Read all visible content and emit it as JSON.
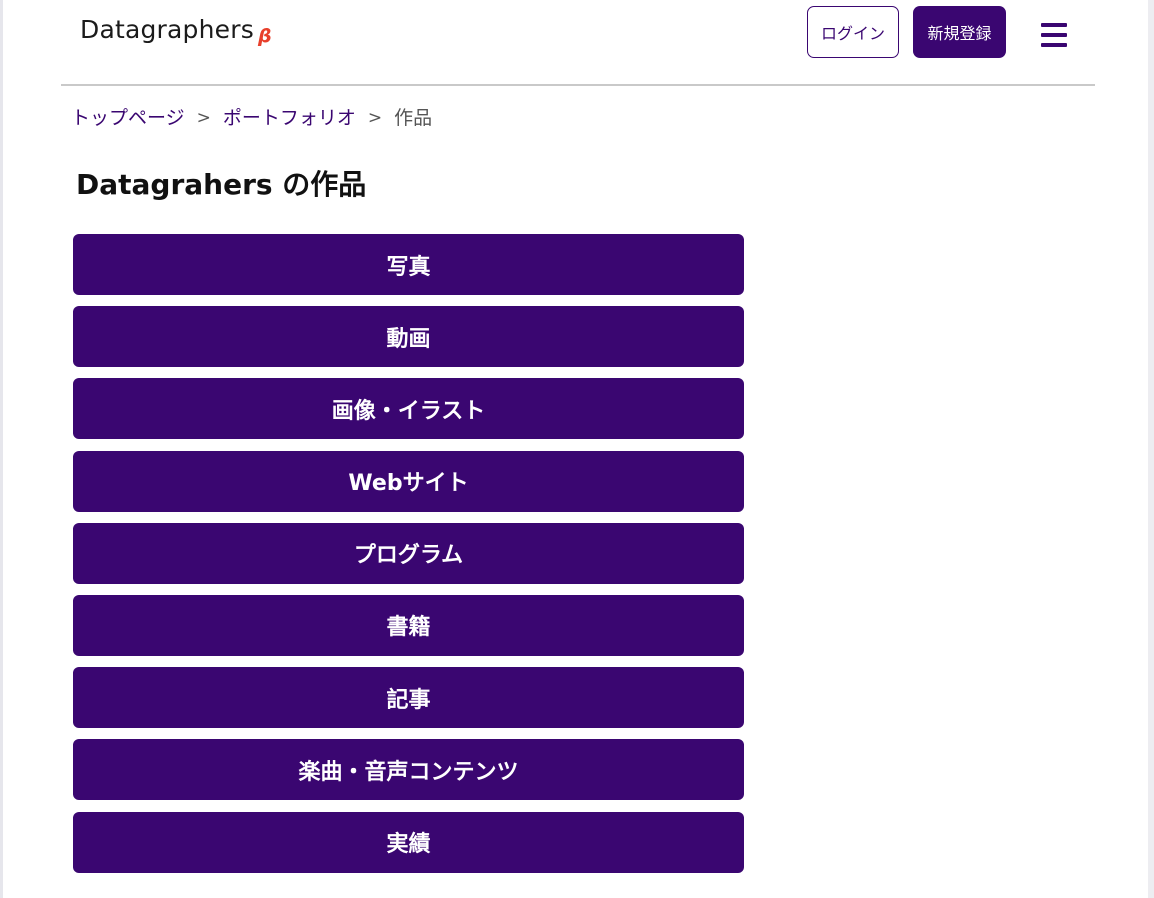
{
  "header": {
    "logo_text": "Datagraphers",
    "logo_badge": "β",
    "login_label": "ログイン",
    "register_label": "新規登録",
    "menu_icon": "hamburger-menu-icon"
  },
  "breadcrumb": {
    "items": [
      "トップページ",
      "ポートフォリオ",
      "作品"
    ],
    "separator": ">"
  },
  "page": {
    "title": "Datagrahers の作品"
  },
  "categories": [
    "写真",
    "動画",
    "画像・イラスト",
    "Webサイト",
    "プログラム",
    "書籍",
    "記事",
    "楽曲・音声コンテンツ",
    "実績"
  ],
  "colors": {
    "brand": "#3a0671",
    "beta": "#e8402c"
  }
}
